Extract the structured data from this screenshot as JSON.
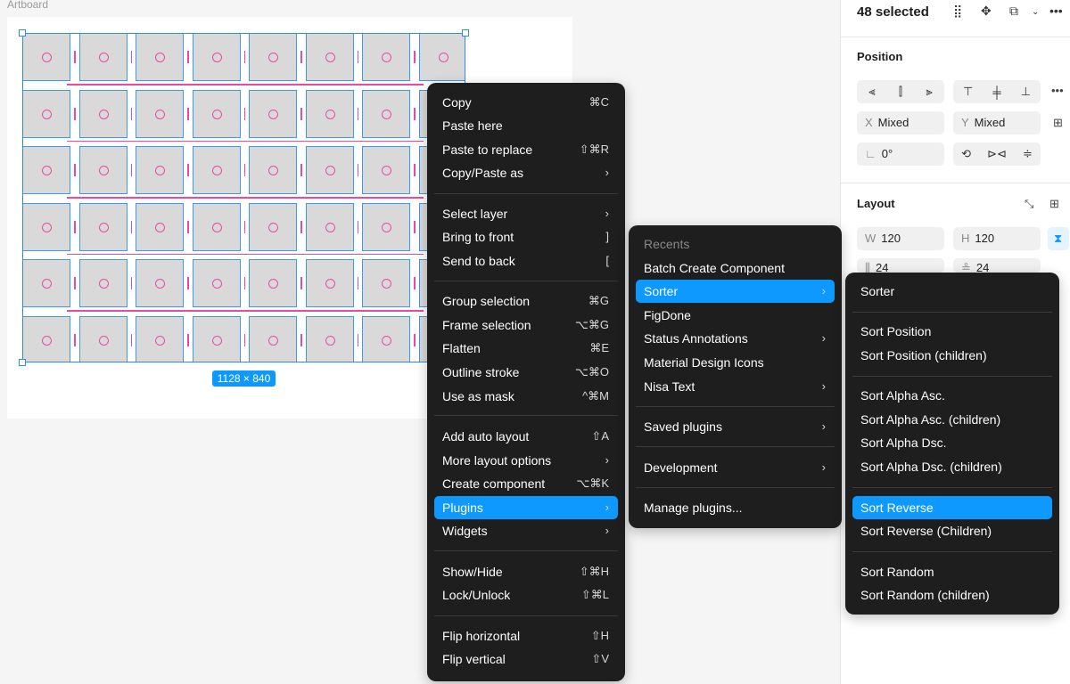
{
  "canvas": {
    "artboard_label": "Artboard",
    "selection_size": "1128 × 840"
  },
  "panel": {
    "selected_count": "48 selected",
    "position": {
      "title": "Position",
      "x_label": "X",
      "x_value": "Mixed",
      "y_label": "Y",
      "y_value": "Mixed",
      "rotation_value": "0°"
    },
    "layout": {
      "title": "Layout",
      "w_label": "W",
      "w_value": "120",
      "h_label": "H",
      "h_value": "120",
      "gap_h_value": "24",
      "gap_v_value": "24"
    }
  },
  "context_menu": {
    "items": [
      {
        "label": "Copy",
        "shortcut": "⌘C"
      },
      {
        "label": "Paste here",
        "shortcut": ""
      },
      {
        "label": "Paste to replace",
        "shortcut": "⇧⌘R"
      },
      {
        "label": "Copy/Paste as",
        "shortcut": "›"
      },
      {
        "label": "Select layer",
        "shortcut": "›"
      },
      {
        "label": "Bring to front",
        "shortcut": "]"
      },
      {
        "label": "Send to back",
        "shortcut": "["
      },
      {
        "label": "Group selection",
        "shortcut": "⌘G"
      },
      {
        "label": "Frame selection",
        "shortcut": "⌥⌘G"
      },
      {
        "label": "Flatten",
        "shortcut": "⌘E"
      },
      {
        "label": "Outline stroke",
        "shortcut": "⌥⌘O"
      },
      {
        "label": "Use as mask",
        "shortcut": "^⌘M"
      },
      {
        "label": "Add auto layout",
        "shortcut": "⇧A"
      },
      {
        "label": "More layout options",
        "shortcut": "›"
      },
      {
        "label": "Create component",
        "shortcut": "⌥⌘K"
      },
      {
        "label": "Plugins",
        "shortcut": "›"
      },
      {
        "label": "Widgets",
        "shortcut": "›"
      },
      {
        "label": "Show/Hide",
        "shortcut": "⇧⌘H"
      },
      {
        "label": "Lock/Unlock",
        "shortcut": "⇧⌘L"
      },
      {
        "label": "Flip horizontal",
        "shortcut": "⇧H"
      },
      {
        "label": "Flip vertical",
        "shortcut": "⇧V"
      }
    ]
  },
  "plugins_menu": {
    "items": [
      {
        "label": "Recents",
        "shortcut": ""
      },
      {
        "label": "Batch Create Component",
        "shortcut": ""
      },
      {
        "label": "Sorter",
        "shortcut": "›"
      },
      {
        "label": "FigDone",
        "shortcut": ""
      },
      {
        "label": "Status Annotations",
        "shortcut": "›"
      },
      {
        "label": "Material Design Icons",
        "shortcut": ""
      },
      {
        "label": "Nisa Text",
        "shortcut": "›"
      },
      {
        "label": "Saved plugins",
        "shortcut": "›"
      },
      {
        "label": "Development",
        "shortcut": "›"
      },
      {
        "label": "Manage plugins...",
        "shortcut": ""
      }
    ]
  },
  "sorter_menu": {
    "items": [
      {
        "label": "Sorter"
      },
      {
        "label": "Sort Position"
      },
      {
        "label": "Sort Position (children)"
      },
      {
        "label": "Sort Alpha Asc."
      },
      {
        "label": "Sort Alpha Asc. (children)"
      },
      {
        "label": "Sort Alpha Dsc."
      },
      {
        "label": "Sort Alpha Dsc. (children)"
      },
      {
        "label": "Sort Reverse"
      },
      {
        "label": "Sort Reverse (Children)"
      },
      {
        "label": "Sort Random"
      },
      {
        "label": "Sort Random (children)"
      }
    ]
  },
  "colors": {
    "accent": "#0d99ff",
    "menu_bg": "#1e1e1e",
    "selection": "#2b8de8",
    "spacing_guide": "#ea4aa6"
  }
}
